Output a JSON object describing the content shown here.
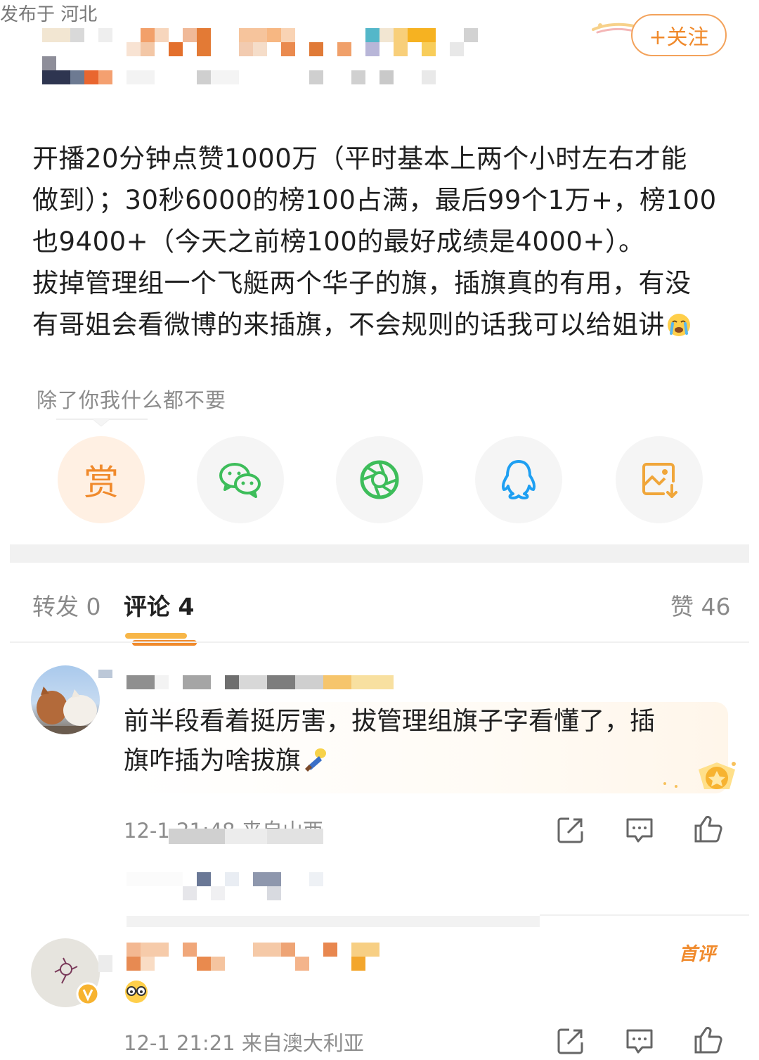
{
  "post": {
    "location": "发布于 河北",
    "follow_label": "+关注",
    "body_lines": [
      "开播20分钟点赞1000万（平时基本上两个小时左右才能",
      "做到）；30秒6000的榜100占满，最后99个1万+，榜100",
      "也9400+（今天之前榜100的最好成绩是4000+）。",
      "拔掉管理组一个飞艇两个华子的旗，插旗真的有用，有没",
      "有哥姐会看微博的来插旗，不会规则的话我可以给姐讲"
    ],
    "body_emoji": "crying-face-emoji",
    "signature": "除了你我什么都不要"
  },
  "share": {
    "reward_label": "赏",
    "icons": [
      "wechat-icon",
      "moments-icon",
      "qq-icon",
      "save-image-icon"
    ]
  },
  "tabs": {
    "repost": "转发 0",
    "comments": "评论 4",
    "likes": "赞 46"
  },
  "comments": [
    {
      "text_line1": "前半段看着挺厉害，拔管理组旗子字看懂了，插",
      "text_line2": "旗咋插为啥拔旗",
      "emoji": "flag-emoji",
      "meta": "12-1 21:48 来自山西"
    },
    {
      "text": "",
      "emoji": "glasses-face-emoji",
      "meta": "12-1 21:21 来自澳大利亚",
      "badge": "首评"
    }
  ],
  "colors": {
    "accent": "#f08a2c",
    "wechat": "#3dbd5a",
    "qq": "#1e9ff2",
    "save": "#f0a63a"
  }
}
